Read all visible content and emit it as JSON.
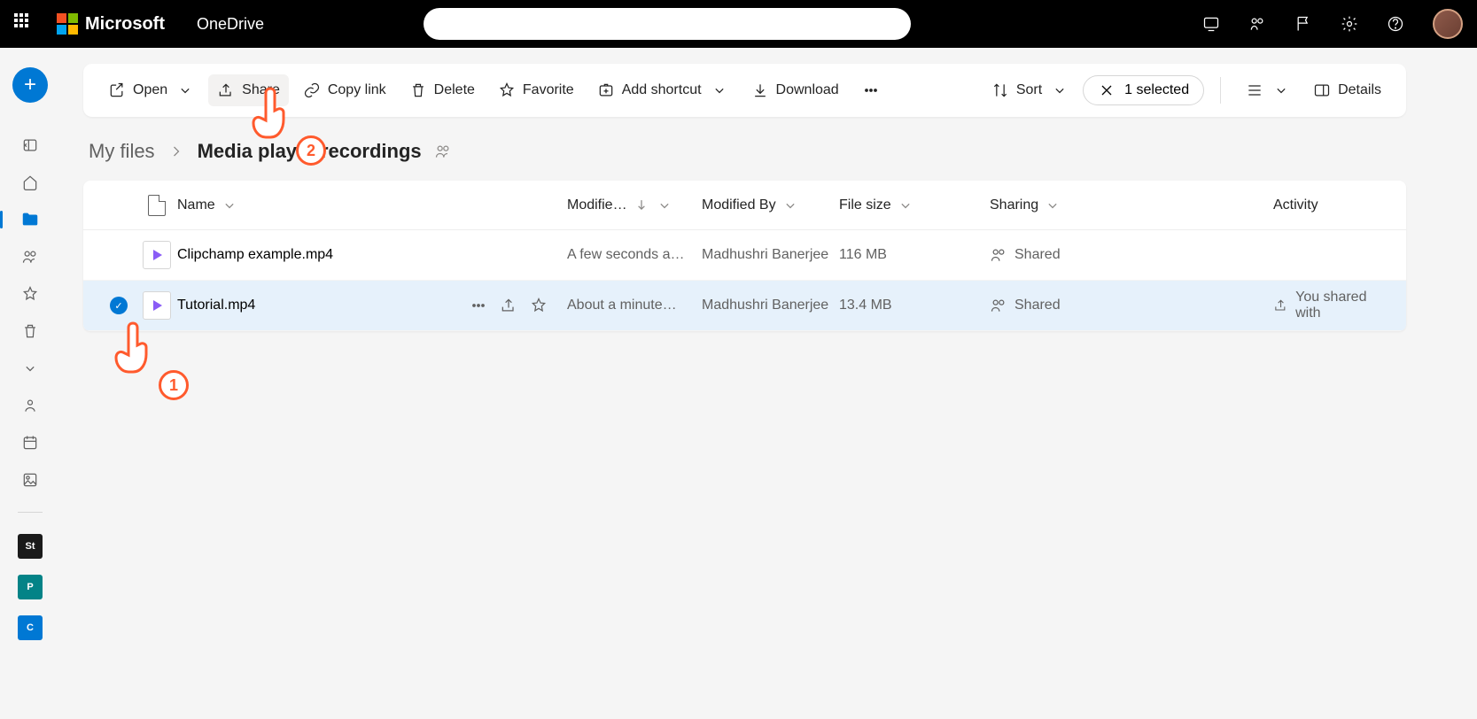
{
  "header": {
    "brand": "Microsoft",
    "app": "OneDrive"
  },
  "toolbar": {
    "open": "Open",
    "share": "Share",
    "copy_link": "Copy link",
    "delete": "Delete",
    "favorite": "Favorite",
    "add_shortcut": "Add shortcut",
    "download": "Download",
    "sort": "Sort",
    "selected_count": "1 selected",
    "details": "Details"
  },
  "breadcrumb": {
    "root": "My files",
    "current": "Media player recordings"
  },
  "columns": {
    "name": "Name",
    "modified": "Modifie…",
    "modified_by": "Modified By",
    "file_size": "File size",
    "sharing": "Sharing",
    "activity": "Activity"
  },
  "files": [
    {
      "name": "Clipchamp example.mp4",
      "modified": "A few seconds a…",
      "modified_by": "Madhushri Banerjee",
      "size": "116 MB",
      "sharing": "Shared",
      "activity": "",
      "selected": false
    },
    {
      "name": "Tutorial.mp4",
      "modified": "About a minute…",
      "modified_by": "Madhushri Banerjee",
      "size": "13.4 MB",
      "sharing": "Shared",
      "activity": "You shared with",
      "selected": true
    }
  ],
  "overlays": {
    "pointer1_num": "1",
    "pointer2_num": "2"
  }
}
